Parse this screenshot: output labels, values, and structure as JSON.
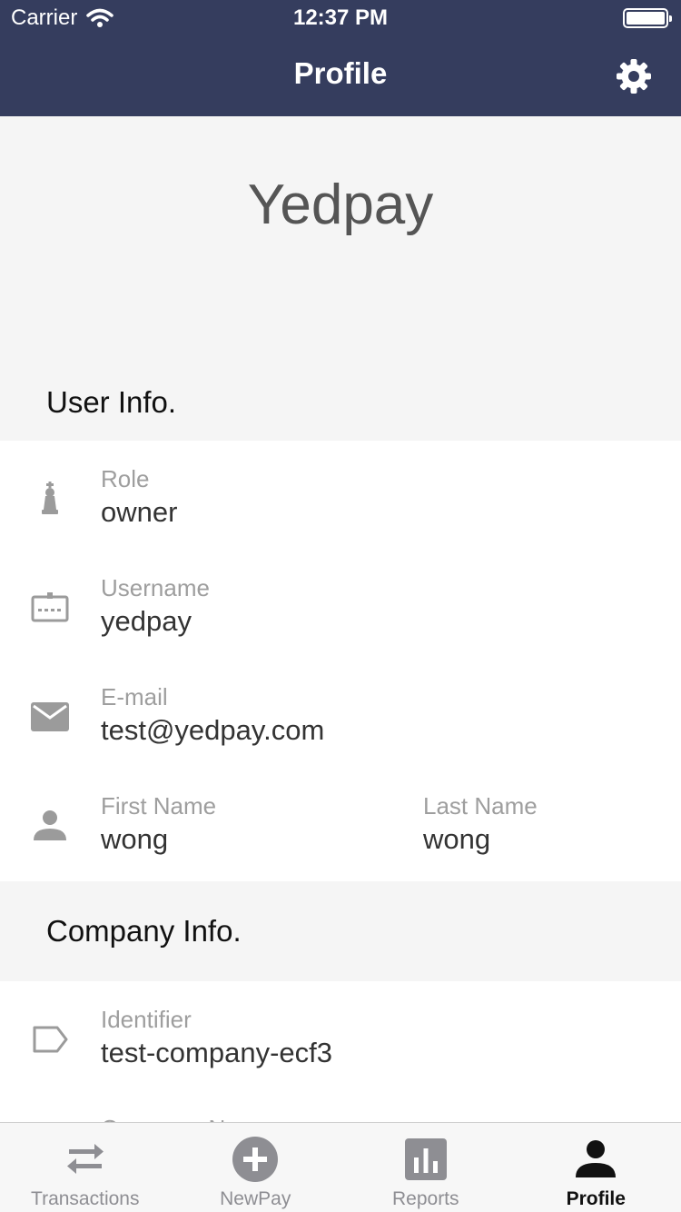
{
  "status_bar": {
    "carrier": "Carrier",
    "time": "12:37 PM"
  },
  "header": {
    "title": "Profile",
    "settings_icon": "gear-icon"
  },
  "brand": "Yedpay",
  "user_info": {
    "title": "User Info.",
    "role": {
      "label": "Role",
      "value": "owner"
    },
    "username": {
      "label": "Username",
      "value": "yedpay"
    },
    "email": {
      "label": "E-mail",
      "value": "test@yedpay.com"
    },
    "first_name": {
      "label": "First Name",
      "value": "wong"
    },
    "last_name": {
      "label": "Last Name",
      "value": "wong"
    }
  },
  "company_info": {
    "title": "Company Info.",
    "identifier": {
      "label": "Identifier",
      "value": "test-company-ecf3"
    },
    "company_name": {
      "label": "Company Name",
      "value": ""
    }
  },
  "tabs": [
    {
      "label": "Transactions",
      "icon": "swap-arrows-icon",
      "active": false
    },
    {
      "label": "NewPay",
      "icon": "plus-circle-icon",
      "active": false
    },
    {
      "label": "Reports",
      "icon": "bar-chart-icon",
      "active": false
    },
    {
      "label": "Profile",
      "icon": "person-icon",
      "active": true
    }
  ],
  "colors": {
    "header": "#353d5e",
    "icon_gray": "#9b9b9b",
    "active_tab": "#111111"
  }
}
